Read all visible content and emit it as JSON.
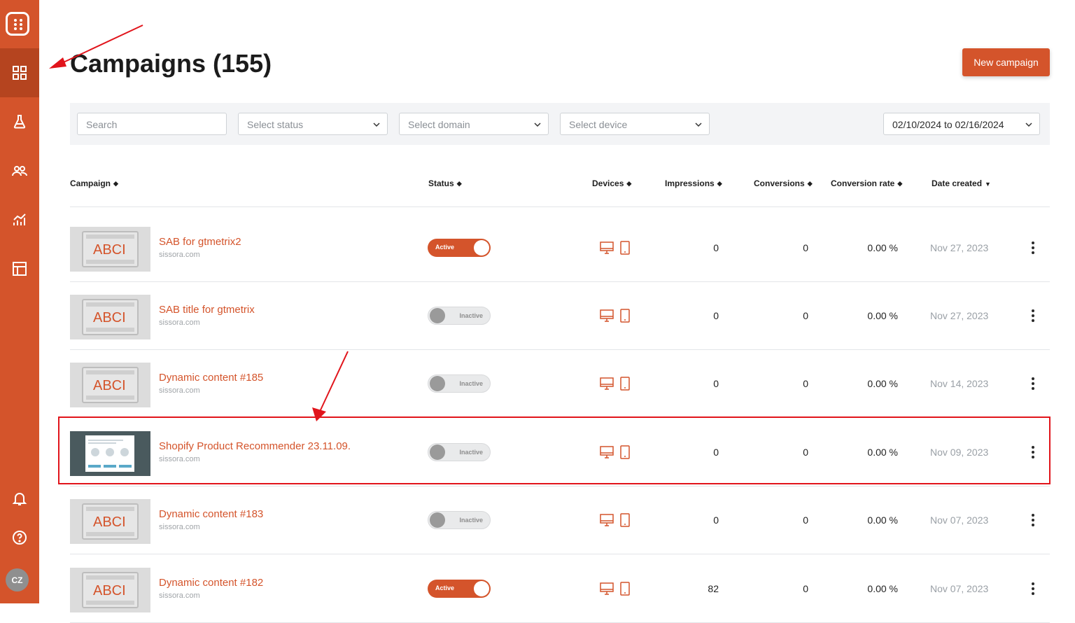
{
  "app": {
    "avatar_initials": "CZ",
    "brand_color": "#d4542b"
  },
  "sidebar": {
    "items": [
      {
        "icon": "dashboard-grid-icon",
        "active": true
      },
      {
        "icon": "flask-icon",
        "active": false
      },
      {
        "icon": "users-icon",
        "active": false
      },
      {
        "icon": "analytics-chart-icon",
        "active": false
      },
      {
        "icon": "layout-template-icon",
        "active": false
      },
      {
        "icon": "bell-icon",
        "active": false
      },
      {
        "icon": "help-icon",
        "active": false
      }
    ]
  },
  "header": {
    "title": "Campaigns (155)",
    "new_campaign_label": "New campaign"
  },
  "filters": {
    "search_placeholder": "Search",
    "status_placeholder": "Select status",
    "domain_placeholder": "Select domain",
    "device_placeholder": "Select device",
    "date_range": "02/10/2024 to 02/16/2024"
  },
  "table": {
    "columns": [
      "Campaign",
      "Status",
      "Devices",
      "Impressions",
      "Conversions",
      "Conversion rate",
      "Date created"
    ],
    "rows": [
      {
        "name": "SAB for gtmetrix2",
        "domain": "sissora.com",
        "status": "Active",
        "impressions": "0",
        "conversions": "0",
        "rate": "0.00 %",
        "created": "Nov 27, 2023"
      },
      {
        "name": "SAB title for gtmetrix",
        "domain": "sissora.com",
        "status": "Inactive",
        "impressions": "0",
        "conversions": "0",
        "rate": "0.00 %",
        "created": "Nov 27, 2023"
      },
      {
        "name": "Dynamic content #185",
        "domain": "sissora.com",
        "status": "Inactive",
        "impressions": "0",
        "conversions": "0",
        "rate": "0.00 %",
        "created": "Nov 14, 2023"
      },
      {
        "name": "Shopify Product Recommender 23.11.09.",
        "domain": "sissora.com",
        "status": "Inactive",
        "impressions": "0",
        "conversions": "0",
        "rate": "0.00 %",
        "created": "Nov 09, 2023"
      },
      {
        "name": "Dynamic content #183",
        "domain": "sissora.com",
        "status": "Inactive",
        "impressions": "0",
        "conversions": "0",
        "rate": "0.00 %",
        "created": "Nov 07, 2023"
      },
      {
        "name": "Dynamic content #182",
        "domain": "sissora.com",
        "status": "Active",
        "impressions": "82",
        "conversions": "0",
        "rate": "0.00 %",
        "created": "Nov 07, 2023"
      }
    ]
  },
  "thumbnail_text": "ABCI"
}
